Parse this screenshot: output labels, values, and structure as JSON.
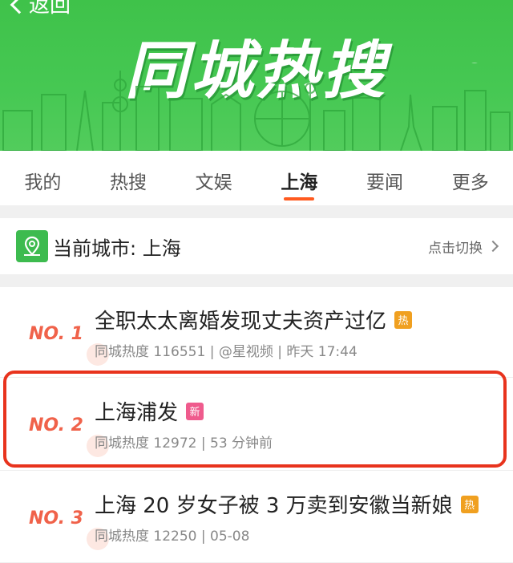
{
  "header": {
    "back_label": "返回",
    "banner_title": "同城热搜"
  },
  "tabs": [
    {
      "label": "我的",
      "active": false
    },
    {
      "label": "热搜",
      "active": false
    },
    {
      "label": "文娱",
      "active": false
    },
    {
      "label": "上海",
      "active": true
    },
    {
      "label": "要闻",
      "active": false
    },
    {
      "label": "更多",
      "active": false
    }
  ],
  "city_bar": {
    "current_city_label": "当前城市: 上海",
    "switch_label": "点击切换"
  },
  "items": [
    {
      "rank": "NO. 1",
      "title": "全职太太离婚发现丈夫资产过亿",
      "badge": "热",
      "badge_type": "hot",
      "meta": "同城热度 116551 | @星视频 | 昨天 17:44"
    },
    {
      "rank": "NO. 2",
      "title": "上海浦发",
      "badge": "新",
      "badge_type": "new",
      "meta": "同城热度 12972 | 53 分钟前",
      "highlighted": true
    },
    {
      "rank": "NO. 3",
      "title": "上海 20 岁女子被 3 万卖到安徽当新娘",
      "badge": "热",
      "badge_type": "hot",
      "meta": "同城热度 12250 | 05-08"
    }
  ],
  "colors": {
    "banner_green": "#46c853",
    "accent_orange": "#ff5a1f",
    "rank_red": "#f0624a",
    "highlight_red": "#e8331d",
    "hot_badge": "#f0a020",
    "new_badge": "#ef5b8d"
  }
}
